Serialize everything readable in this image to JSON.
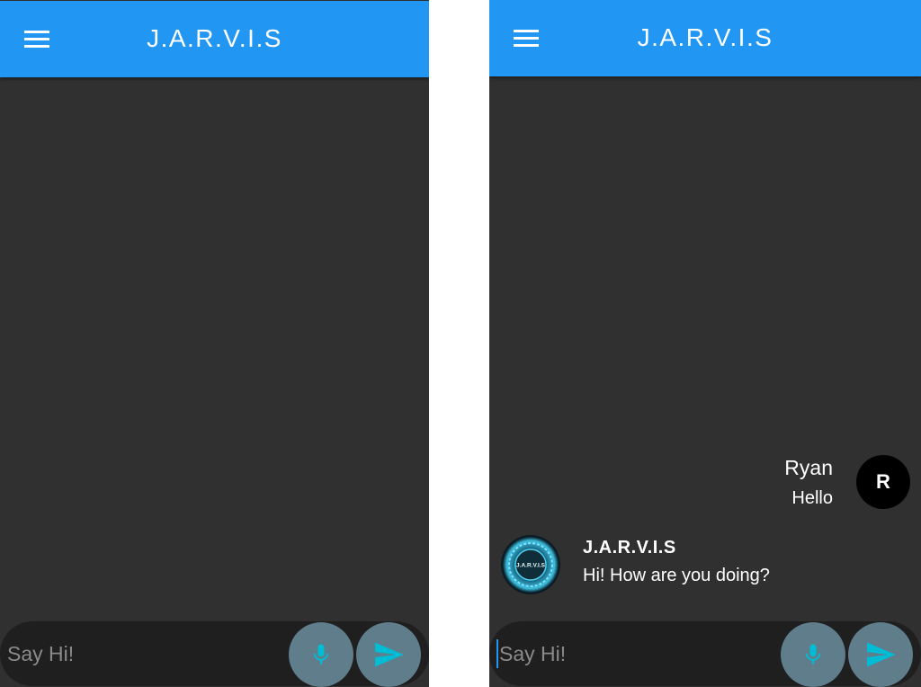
{
  "colors": {
    "appbar": "#2196f3",
    "background": "#303030",
    "input_bar": "#1f1f1f",
    "action_button": "#607d8b",
    "icon_accent": "#00bcd4",
    "user_avatar": "#000000"
  },
  "left_screen": {
    "title": "J.A.R.V.I.S",
    "input": {
      "placeholder": "Say Hi!",
      "value": ""
    }
  },
  "right_screen": {
    "title": "J.A.R.V.I.S",
    "messages": [
      {
        "sender": "Ryan",
        "avatar_letter": "R",
        "text": "Hello"
      },
      {
        "sender": "J.A.R.V.I.S",
        "avatar_label": "J.A.R.V.I.S",
        "text": "Hi! How are you doing?"
      }
    ],
    "input": {
      "placeholder": "Say Hi!",
      "value": ""
    }
  },
  "icons": {
    "menu": "menu-icon",
    "mic": "mic-icon",
    "send": "send-icon"
  }
}
